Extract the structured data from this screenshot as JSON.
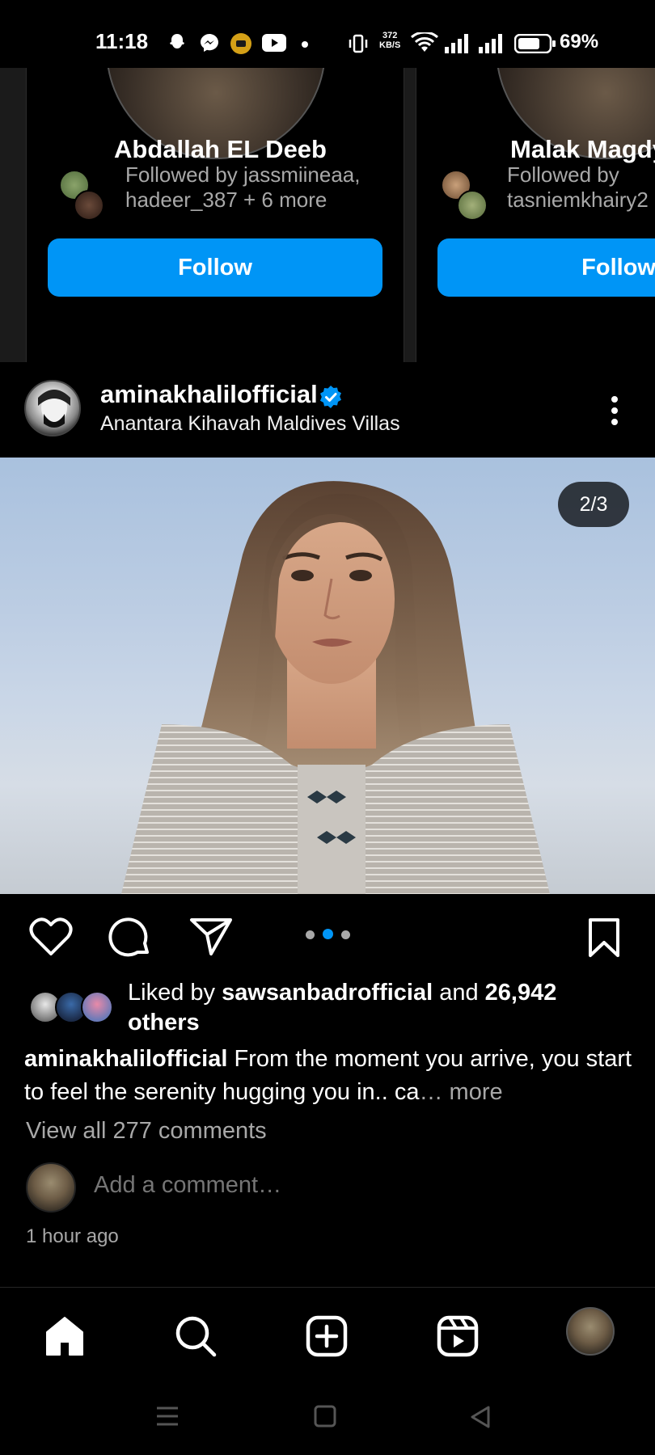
{
  "status_bar": {
    "time": "11:18",
    "data_rate_value": "372",
    "data_rate_unit": "KB/S",
    "battery_percent": "69%",
    "notification_icons": [
      "snapchat-icon",
      "messenger-icon",
      "app-badge-icon",
      "youtube-icon",
      "dot-icon"
    ],
    "system_icons": [
      "vibrate-icon",
      "wifi-icon",
      "signal-icon",
      "signal-icon",
      "battery-icon"
    ]
  },
  "suggestions": [
    {
      "name": "Abdallah EL Deeb",
      "followed_by_line1": "Followed by jassmiineaa,",
      "followed_by_line2": "hadeer_387 + 6 more",
      "button": "Follow"
    },
    {
      "name": "Malak Magdy",
      "followed_by_line1": "Followed by",
      "followed_by_line2": "tasniemkhairy2",
      "button": "Follow"
    }
  ],
  "post": {
    "username": "aminakhalilofficial",
    "verified": true,
    "location": "Anantara Kihavah Maldives Villas",
    "image_counter": "2/3",
    "carousel_dots": 3,
    "carousel_active": 2,
    "likes": {
      "prefix": "Liked by ",
      "user": "sawsanbadrofficial",
      "middle": " and ",
      "count": "26,942",
      "suffix": " others"
    },
    "caption": {
      "username": "aminakhalilofficial",
      "text": " From the moment you arrive, you start to feel the serenity hugging you in.. ca",
      "ellipsis": "…",
      "more": " more"
    },
    "view_comments": "View all 277 comments",
    "comment_placeholder": "Add a comment…",
    "timestamp": "1 hour ago"
  },
  "colors": {
    "accent": "#0095f6",
    "background": "#000000",
    "muted_text": "#a8a8a8"
  },
  "bottom_nav": [
    "home-icon",
    "search-icon",
    "create-post-icon",
    "reels-icon",
    "profile-avatar"
  ],
  "system_nav": [
    "menu-icon",
    "home-square-icon",
    "back-triangle-icon"
  ]
}
